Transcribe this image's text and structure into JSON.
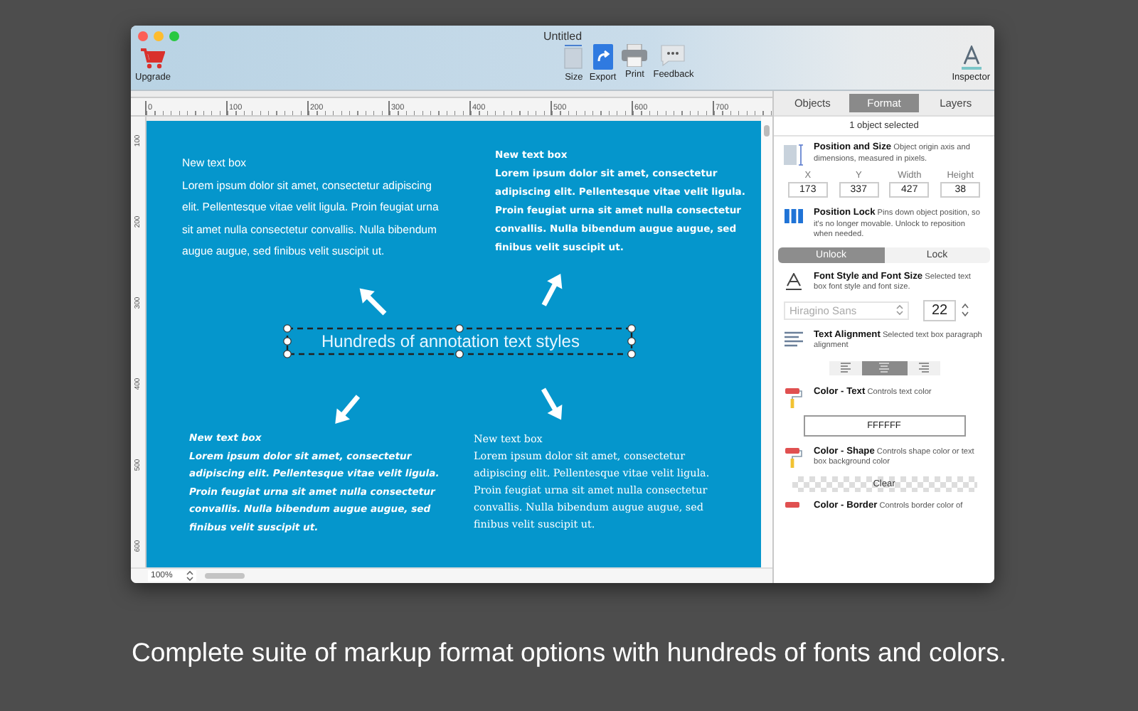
{
  "window": {
    "title": "Untitled"
  },
  "toolbar": {
    "left": [
      {
        "kind": "cart",
        "label": "Upgrade"
      }
    ],
    "center": [
      {
        "kind": "page",
        "label": "Size"
      },
      {
        "kind": "export",
        "label": "Export"
      },
      {
        "kind": "print",
        "label": "Print"
      },
      {
        "kind": "feedback",
        "label": "Feedback"
      }
    ],
    "right": [
      {
        "kind": "inspector",
        "label": "Inspector"
      }
    ]
  },
  "ruler": {
    "h_labels": [
      "0",
      "100",
      "200",
      "300",
      "400",
      "500",
      "600",
      "700"
    ],
    "v_labels": [
      "100",
      "200",
      "300",
      "400",
      "500",
      "600"
    ]
  },
  "canvas": {
    "text_boxes": [
      {
        "kind": "sans",
        "title": "New text box",
        "body": "Lorem ipsum dolor sit amet, consectetur adipiscing elit. Pellentesque vitae velit ligula. Proin feugiat urna sit amet nulla consectetur convallis. Nulla bibendum augue augue, sed finibus velit suscipit ut."
      },
      {
        "kind": "marker",
        "title": "New text box",
        "body": "Lorem ipsum dolor sit amet, consectetur adipiscing elit. Pellentesque vitae velit ligula. Proin feugiat urna sit amet nulla consectetur convallis. Nulla bibendum augue augue, sed finibus velit suscipit ut."
      },
      {
        "kind": "script",
        "title": "New text box",
        "body": "Lorem ipsum dolor sit amet, consectetur adipiscing elit. Pellentesque vitae velit ligula. Proin feugiat urna sit amet nulla consectetur convallis. Nulla bibendum augue augue, sed finibus velit suscipit ut."
      },
      {
        "kind": "hand",
        "title": "New text box",
        "body": "Lorem ipsum dolor sit amet, consectetur adipiscing elit. Pellentesque vitae velit ligula. Proin feugiat urna sit amet nulla consectetur convallis. Nulla bibendum augue augue, sed finibus velit suscipit ut."
      }
    ],
    "selected_box": {
      "text": "Hundreds of annotation text styles"
    }
  },
  "zoom": {
    "value": "100%"
  },
  "inspector": {
    "tabs": [
      {
        "label": "Objects",
        "selected": false
      },
      {
        "label": "Format",
        "selected": true
      },
      {
        "label": "Layers",
        "selected": false
      }
    ],
    "selection_label": "1 object selected",
    "position": {
      "title": "Position and Size",
      "description": "Object origin axis and dimensions, measured in pixels.",
      "fields": [
        {
          "label": "X",
          "value": "173"
        },
        {
          "label": "Y",
          "value": "337"
        },
        {
          "label": "Width",
          "value": "427"
        },
        {
          "label": "Height",
          "value": "38"
        }
      ]
    },
    "lock": {
      "title": "Position Lock",
      "description": "Pins down object position, so it's no longer movable.  Unlock to reposition when needed.",
      "options": [
        {
          "label": "Unlock",
          "selected": true
        },
        {
          "label": "Lock",
          "selected": false
        }
      ]
    },
    "font": {
      "title": "Font Style and Font Size",
      "description": "Selected text box font style and font size.",
      "family": "Hiragino Sans",
      "size": "22"
    },
    "alignment": {
      "title": "Text Alignment",
      "description": "Selected text box paragraph alignment",
      "options": [
        {
          "kind": "left",
          "selected": false
        },
        {
          "kind": "center",
          "selected": true
        },
        {
          "kind": "right",
          "selected": false
        }
      ]
    },
    "color_text": {
      "title": "Color - Text",
      "description": "Controls text color",
      "value": "FFFFFF"
    },
    "color_shape": {
      "title": "Color - Shape",
      "description": "Controls shape color or text box background color",
      "button": "Clear"
    },
    "color_border": {
      "title": "Color - Border",
      "description": "Controls border color of"
    }
  },
  "caption": "Complete suite of markup format options with hundreds of fonts and colors."
}
